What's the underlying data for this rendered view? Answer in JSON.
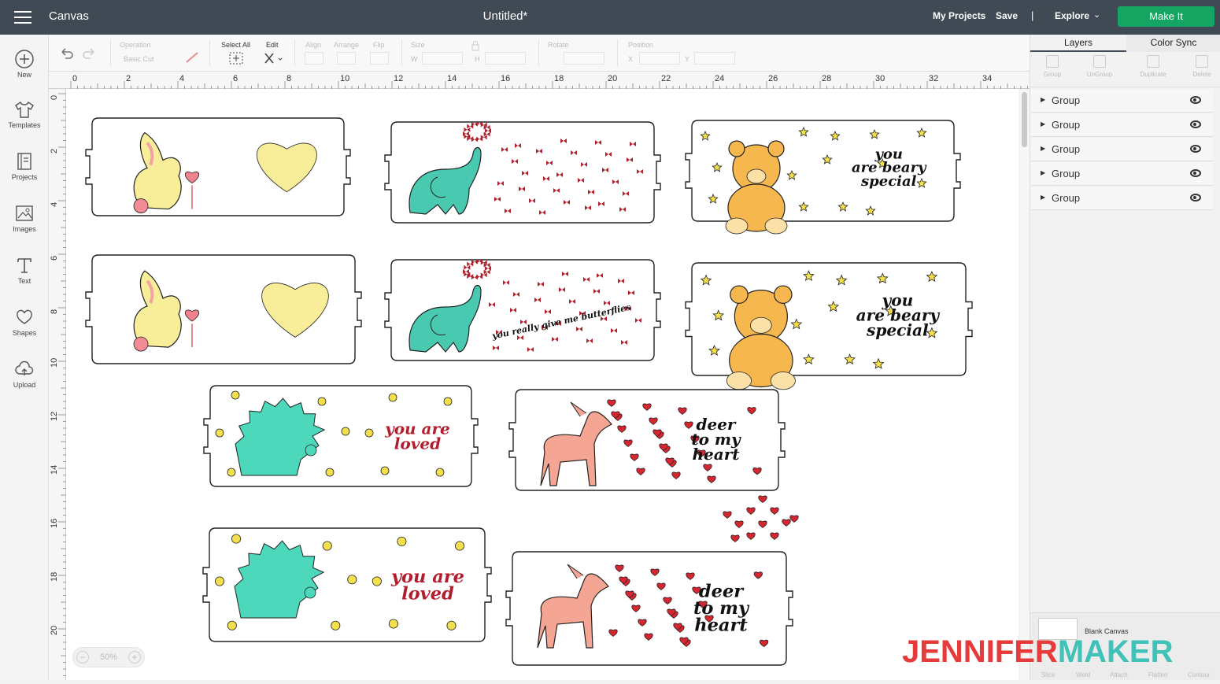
{
  "topbar": {
    "app_name": "Canvas",
    "doc_title": "Untitled*",
    "my_projects": "My Projects",
    "save": "Save",
    "separator": "|",
    "explore": "Explore",
    "make_it": "Make It",
    "make_it_color": "#15a462"
  },
  "left_nav": [
    {
      "label": "New",
      "icon": "plus-circle-icon"
    },
    {
      "label": "Templates",
      "icon": "shirt-icon"
    },
    {
      "label": "Projects",
      "icon": "projects-icon"
    },
    {
      "label": "Images",
      "icon": "image-icon"
    },
    {
      "label": "Text",
      "icon": "text-icon"
    },
    {
      "label": "Shapes",
      "icon": "shapes-icon"
    },
    {
      "label": "Upload",
      "icon": "upload-icon"
    }
  ],
  "edit_bar": {
    "operation_label": "Operation",
    "operation_value": "Basic Cut",
    "select_all": "Select All",
    "edit": "Edit",
    "align": "Align",
    "arrange": "Arrange",
    "flip": "Flip",
    "size": "Size",
    "w": "W",
    "h": "H",
    "rotate": "Rotate",
    "position": "Position",
    "x": "X",
    "y": "Y"
  },
  "ruler": {
    "top": [
      "0",
      "2",
      "4",
      "6",
      "8",
      "10",
      "12",
      "14",
      "16",
      "18",
      "20",
      "22",
      "24",
      "26",
      "28",
      "30",
      "32",
      "34"
    ],
    "left": [
      "0",
      "2",
      "4",
      "6",
      "8",
      "10",
      "12",
      "14",
      "16",
      "18",
      "20"
    ]
  },
  "right_panel": {
    "tabs": [
      "Layers",
      "Color Sync"
    ],
    "tools": [
      "Group",
      "UnGroup",
      "Duplicate",
      "Delete"
    ],
    "layers": [
      "Group",
      "Group",
      "Group",
      "Group",
      "Group"
    ],
    "blank_canvas": "Blank Canvas",
    "bottom_tools": [
      "Slice",
      "Weld",
      "Attach",
      "Flatten",
      "Contour"
    ]
  },
  "zoom": {
    "value": "50%",
    "minus": "−",
    "plus": "+"
  },
  "canvas": {
    "cards": [
      {
        "design": "bunny-heart",
        "text": ""
      },
      {
        "design": "elephant",
        "text": ""
      },
      {
        "design": "bear",
        "text": "you are beary special"
      },
      {
        "design": "bunny-heart",
        "text": ""
      },
      {
        "design": "elephant",
        "text": "you really give me butterflies"
      },
      {
        "design": "bear",
        "text": "you are beary special"
      },
      {
        "design": "hedgehog",
        "text": "you are loved"
      },
      {
        "design": "deer",
        "text": "deer to my heart"
      },
      {
        "design": "hedgehog",
        "text": "you are loved"
      },
      {
        "design": "deer",
        "text": "deer to my heart"
      }
    ]
  },
  "watermark": {
    "part1": "JENNIFER",
    "part2": "MAKER"
  }
}
